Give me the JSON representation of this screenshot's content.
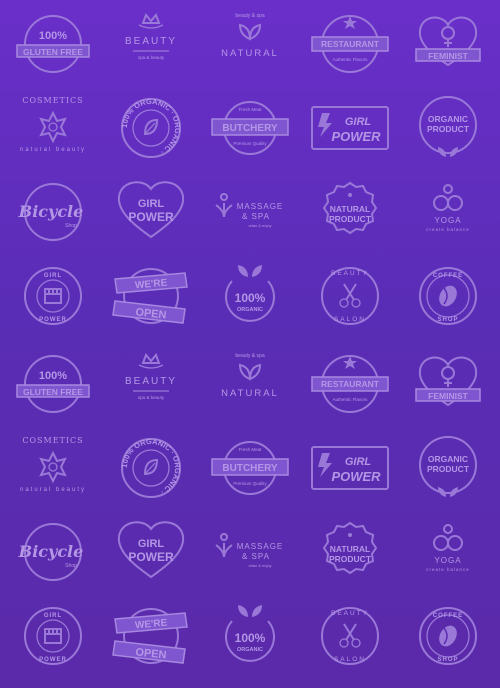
{
  "colors": {
    "background_top": "#6a2fc9",
    "background_bottom": "#5a2aa9",
    "logo": "#9a78d8"
  },
  "logos": [
    {
      "type": "gluten-free",
      "texts": [
        "100%",
        "GLUTEN FREE"
      ]
    },
    {
      "type": "beauty",
      "texts": [
        "BEAUTY",
        "spa & beauty"
      ]
    },
    {
      "type": "natural",
      "texts": [
        "beauty & spa",
        "NATURAL"
      ]
    },
    {
      "type": "restaurant",
      "texts": [
        "RESTAURANT",
        "Authentic Flavors"
      ]
    },
    {
      "type": "feminist",
      "texts": [
        "FEMINIST"
      ]
    },
    {
      "type": "cosmetics",
      "texts": [
        "COSMETICS",
        "natural beauty"
      ]
    },
    {
      "type": "organic-circle",
      "texts": [
        "100% ORGANIC · ORGANIC ·"
      ]
    },
    {
      "type": "butchery",
      "texts": [
        "BUTCHERY",
        "Fresh Meat",
        "Premium Quality"
      ]
    },
    {
      "type": "girl-power-bolt",
      "texts": [
        "GIRL",
        "POWER"
      ]
    },
    {
      "type": "organic-product",
      "texts": [
        "ORGANIC",
        "PRODUCT"
      ]
    },
    {
      "type": "bicycle",
      "texts": [
        "Bicycle",
        "Shop"
      ]
    },
    {
      "type": "girl-power-heart",
      "texts": [
        "GIRL",
        "POWER"
      ]
    },
    {
      "type": "massage",
      "texts": [
        "MASSAGE",
        "& SPA",
        "relax & enjoy"
      ]
    },
    {
      "type": "natural-product",
      "texts": [
        "NATURAL",
        "PRODUCT"
      ]
    },
    {
      "type": "yoga",
      "texts": [
        "YOGA",
        "create balance"
      ]
    },
    {
      "type": "girl-power-fist",
      "texts": [
        "GIRL",
        "POWER"
      ]
    },
    {
      "type": "were-open",
      "texts": [
        "WE'RE",
        "OPEN"
      ]
    },
    {
      "type": "organic-100",
      "texts": [
        "100%",
        "ORGANIC"
      ]
    },
    {
      "type": "beauty-salon",
      "texts": [
        "BEAUTY",
        "SALON"
      ]
    },
    {
      "type": "coffee-shop",
      "texts": [
        "COFFEE",
        "SHOP"
      ]
    },
    {
      "type": "gluten-free",
      "texts": [
        "100%",
        "GLUTEN FREE"
      ]
    },
    {
      "type": "beauty",
      "texts": [
        "BEAUTY",
        "spa & beauty"
      ]
    },
    {
      "type": "natural",
      "texts": [
        "beauty & spa",
        "NATURAL"
      ]
    },
    {
      "type": "restaurant",
      "texts": [
        "RESTAURANT",
        "Authentic Flavors"
      ]
    },
    {
      "type": "feminist",
      "texts": [
        "FEMINIST"
      ]
    },
    {
      "type": "cosmetics",
      "texts": [
        "COSMETICS",
        "natural beauty"
      ]
    },
    {
      "type": "organic-circle",
      "texts": [
        "100% ORGANIC · ORGANIC ·"
      ]
    },
    {
      "type": "butchery",
      "texts": [
        "BUTCHERY",
        "Fresh Meat",
        "Premium Quality"
      ]
    },
    {
      "type": "girl-power-bolt",
      "texts": [
        "GIRL",
        "POWER"
      ]
    },
    {
      "type": "organic-product",
      "texts": [
        "ORGANIC",
        "PRODUCT"
      ]
    },
    {
      "type": "bicycle",
      "texts": [
        "Bicycle",
        "Shop"
      ]
    },
    {
      "type": "girl-power-heart",
      "texts": [
        "GIRL",
        "POWER"
      ]
    },
    {
      "type": "massage",
      "texts": [
        "MASSAGE",
        "& SPA",
        "relax & enjoy"
      ]
    },
    {
      "type": "natural-product",
      "texts": [
        "NATURAL",
        "PRODUCT"
      ]
    },
    {
      "type": "yoga",
      "texts": [
        "YOGA",
        "create balance"
      ]
    },
    {
      "type": "girl-power-fist",
      "texts": [
        "GIRL",
        "POWER"
      ]
    },
    {
      "type": "were-open",
      "texts": [
        "WE'RE",
        "OPEN"
      ]
    },
    {
      "type": "organic-100",
      "texts": [
        "100%",
        "ORGANIC"
      ]
    },
    {
      "type": "beauty-salon",
      "texts": [
        "BEAUTY",
        "SALON"
      ]
    },
    {
      "type": "coffee-shop",
      "texts": [
        "COFFEE",
        "SHOP"
      ]
    }
  ]
}
